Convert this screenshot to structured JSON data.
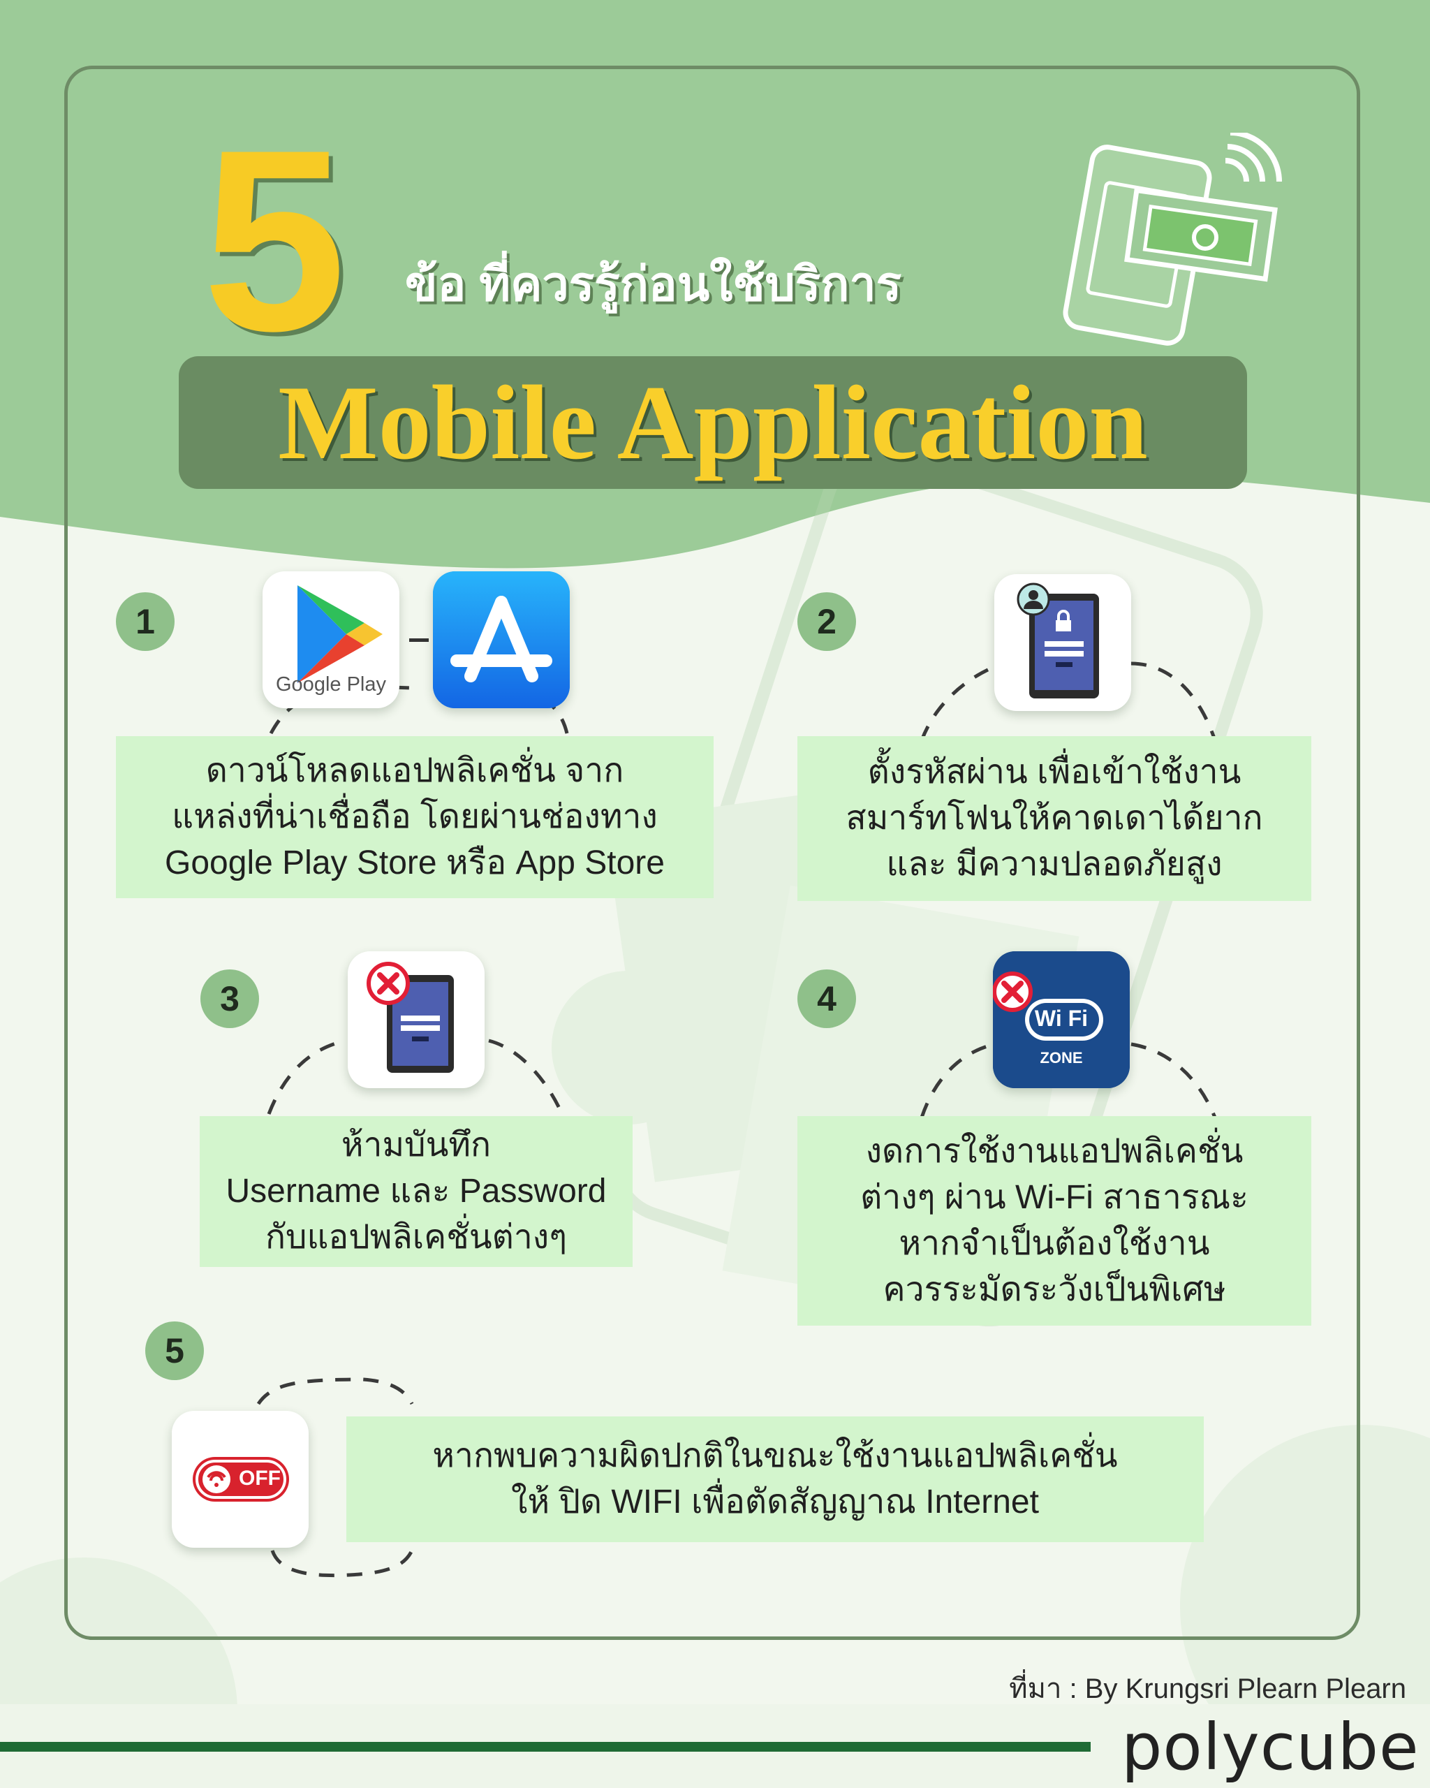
{
  "header": {
    "number": "5",
    "headline": "ข้อ ที่ควรรู้ก่อนใช้บริการ",
    "banner": "Mobile Application"
  },
  "tips": [
    {
      "number": "1",
      "lines": [
        "ดาวน์โหลดแอปพลิเคชั่น จาก",
        "แหล่งที่น่าเชื่อถือ โดยผ่านช่องทาง",
        "Google Play Store หรือ App Store"
      ],
      "icon": "google-play-and-app-store-icons"
    },
    {
      "number": "2",
      "lines": [
        "ตั้งรหัสผ่าน เพื่อเข้าใช้งาน",
        "สมาร์ทโฟนให้คาดเดาได้ยาก",
        "และ มีความปลอดภัยสูง"
      ],
      "icon": "locked-phone-icon"
    },
    {
      "number": "3",
      "lines": [
        "ห้ามบันทึก",
        "Username และ Password",
        "กับแอปพลิเคชั่นต่างๆ"
      ],
      "icon": "phone-login-denied-icon"
    },
    {
      "number": "4",
      "lines": [
        "งดการใช้งานแอปพลิเคชั่น",
        "ต่างๆ ผ่าน Wi-Fi สาธารณะ",
        "หากจำเป็นต้องใช้งาน",
        "ควรระมัดระวังเป็นพิเศษ"
      ],
      "icon": "wifi-zone-denied-icon"
    },
    {
      "number": "5",
      "lines": [
        "หากพบความผิดปกติในขณะใช้งานแอปพลิเคชั่น",
        "ให้ ปิด WIFI เพื่อตัดสัญญาณ Internet"
      ],
      "icon": "wifi-off-icon"
    }
  ],
  "icon_labels": {
    "google_play": "Google Play",
    "wifi_word": "Wi Fi",
    "wifi_zone": "ZONE",
    "wifi_off": "OFF"
  },
  "footer": {
    "source": "ที่มา : By Krungsri Plearn Plearn",
    "logo": "polycube"
  },
  "colors": {
    "background_green": "#9ccb98",
    "frame": "#6e8c66",
    "banner": "#6a8c62",
    "title_yellow": "#f7cb25",
    "textbox": "#d3f5cd",
    "number_badge": "#8fc08a",
    "footer_line": "#1f6b35"
  }
}
